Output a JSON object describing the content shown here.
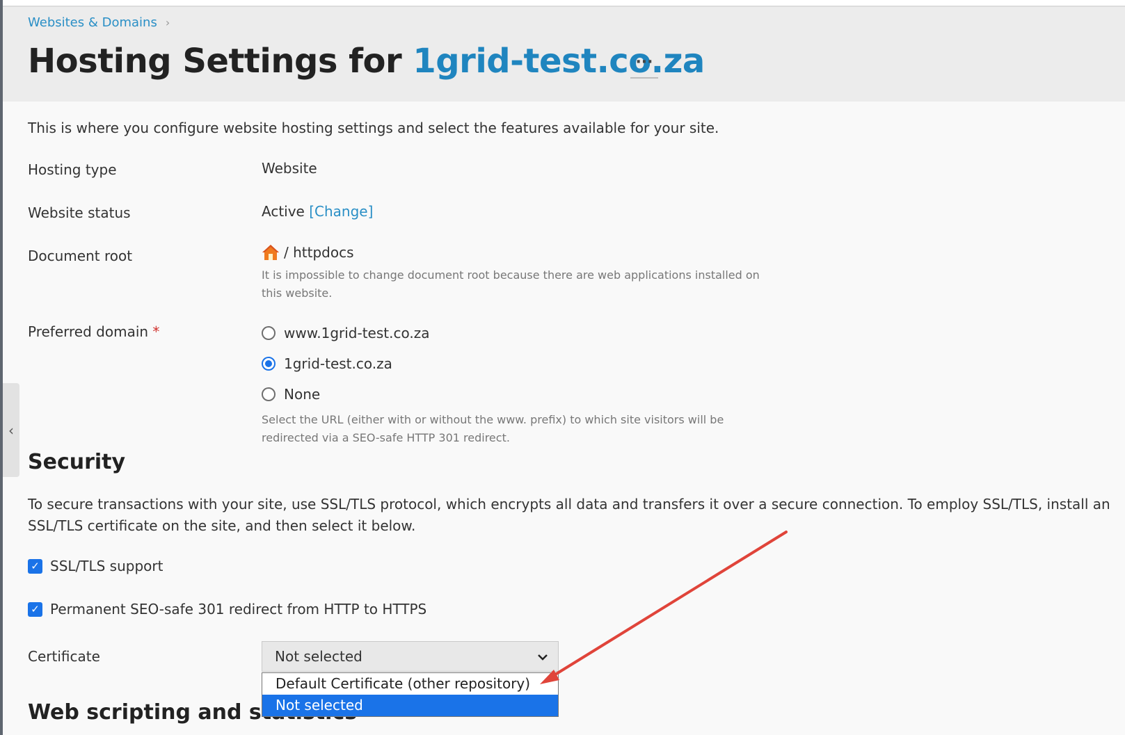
{
  "breadcrumb": {
    "item": "Websites & Domains",
    "separator": "›"
  },
  "title": {
    "prefix": "Hosting Settings for",
    "domain": "1grid-test.co.za",
    "more": "···"
  },
  "intro": "This is where you configure website hosting settings and select the features available for your site.",
  "fields": {
    "hosting_type": {
      "label": "Hosting type",
      "value": "Website"
    },
    "website_status": {
      "label": "Website status",
      "value": "Active",
      "action": "[Change]"
    },
    "document_root": {
      "label": "Document root",
      "value": "/ httpdocs",
      "hint_line1": "It is impossible to change document root because there are web applications installed on",
      "hint_line2": "this website."
    },
    "preferred_domain": {
      "label": "Preferred domain",
      "required_mark": "*",
      "options": [
        "www.1grid-test.co.za",
        "1grid-test.co.za",
        "None"
      ],
      "selected": "1grid-test.co.za",
      "hint_line1": "Select the URL (either with or without the www. prefix) to which site visitors will be",
      "hint_line2": "redirected via a SEO-safe HTTP 301 redirect."
    }
  },
  "security": {
    "title": "Security",
    "description": "To secure transactions with your site, use SSL/TLS protocol, which encrypts all data and transfers it over a secure connection. To employ SSL/TLS, install an SSL/TLS certificate on the site, and then select it below.",
    "ssl_support": {
      "label": "SSL/TLS support",
      "checked": true
    },
    "redirect_https": {
      "label": "Permanent SEO-safe 301 redirect from HTTP to HTTPS",
      "checked": true
    },
    "certificate": {
      "label": "Certificate",
      "selected": "Not selected",
      "options": [
        "Default Certificate (other repository)",
        "Not selected"
      ]
    }
  },
  "web_scripting": {
    "title": "Web scripting and statistics"
  },
  "colors": {
    "accent": "#1a73e8",
    "link": "#2a8fc6",
    "annotation_arrow": "#e0443a"
  },
  "icons": {
    "home": "home-icon",
    "collapse": "chevron-left-icon",
    "dropdown": "chevron-down-icon"
  }
}
